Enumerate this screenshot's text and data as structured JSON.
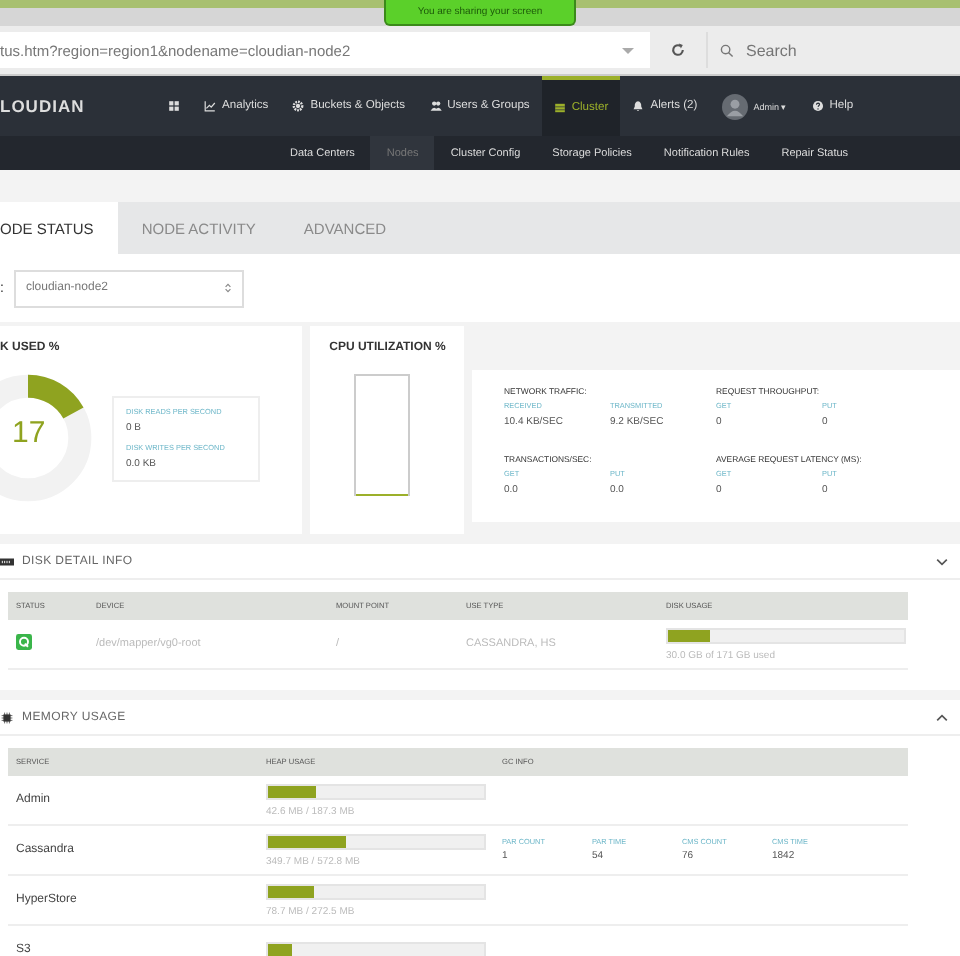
{
  "banner": "You are sharing your screen",
  "browser": {
    "url": "tus.htm?region=region1&nodename=cloudian-node2",
    "search_placeholder": "Search"
  },
  "logo": "LOUDIAN",
  "nav": [
    {
      "kind": "grid",
      "selected": false
    },
    {
      "kind": "chart",
      "label": "Analytics",
      "selected": false
    },
    {
      "kind": "gear",
      "label": "Buckets & Objects",
      "selected": false
    },
    {
      "kind": "users",
      "label": "Users & Groups",
      "selected": false
    },
    {
      "kind": "cluster",
      "label": "Cluster",
      "selected": true
    },
    {
      "kind": "bell",
      "label": "Alerts (2)",
      "selected": false
    },
    {
      "kind": "avatar",
      "label": "Admin ▾",
      "selected": false
    },
    {
      "kind": "help",
      "label": "Help",
      "selected": false
    }
  ],
  "subnav": [
    {
      "label": "Data Centers",
      "selected": false
    },
    {
      "label": "Nodes",
      "selected": true
    },
    {
      "label": "Cluster Config",
      "selected": false
    },
    {
      "label": "Storage Policies",
      "selected": false
    },
    {
      "label": "Notification Rules",
      "selected": false
    },
    {
      "label": "Repair Status",
      "selected": false
    }
  ],
  "tabs": [
    {
      "label": "ODE STATUS",
      "selected": true
    },
    {
      "label": "NODE ACTIVITY",
      "selected": false
    },
    {
      "label": "ADVANCED",
      "selected": false
    }
  ],
  "node_select": {
    "label": ":",
    "value": "cloudian-node2"
  },
  "disk_used": {
    "title": "K USED %",
    "value": "17",
    "stats": [
      {
        "label": "DISK READS PER SECOND",
        "value": "0 B"
      },
      {
        "label": "DISK WRITES PER SECOND",
        "value": "0.0 KB"
      }
    ]
  },
  "cpu": {
    "title": "CPU UTILIZATION %",
    "level": 0.02
  },
  "metrics": [
    {
      "title": "NETWORK TRAFFIC:",
      "items": [
        {
          "label": "RECEIVED",
          "value": "10.4 KB/SEC"
        },
        {
          "label": "TRANSMITTED",
          "value": "9.2 KB/SEC"
        }
      ]
    },
    {
      "title": "REQUEST THROUGHPUT:",
      "items": [
        {
          "label": "GET",
          "value": "0"
        },
        {
          "label": "PUT",
          "value": "0"
        }
      ]
    },
    {
      "title": "TRANSACTIONS/SEC:",
      "items": [
        {
          "label": "GET",
          "value": "0.0"
        },
        {
          "label": "PUT",
          "value": "0.0"
        }
      ]
    },
    {
      "title": "AVERAGE REQUEST LATENCY (MS):",
      "items": [
        {
          "label": "GET",
          "value": "0"
        },
        {
          "label": "PUT",
          "value": "0"
        }
      ]
    }
  ],
  "disk_detail": {
    "title": "DISK DETAIL INFO",
    "expanded": false,
    "columns": [
      "STATUS",
      "DEVICE",
      "MOUNT POINT",
      "USE TYPE",
      "DISK USAGE"
    ],
    "rows": [
      {
        "device": "/dev/mapper/vg0-root",
        "mount": "/",
        "use_type": "CASSANDRA, HS",
        "level": 0.18,
        "usage": "30.0 GB of 171 GB used"
      }
    ]
  },
  "memory": {
    "title": "MEMORY USAGE",
    "expanded": true,
    "columns": [
      "SERVICE",
      "HEAP USAGE",
      "GC INFO"
    ],
    "rows": [
      {
        "service": "Admin",
        "level": 0.22,
        "heap": "42.6 MB / 187.3 MB"
      },
      {
        "service": "Cassandra",
        "level": 0.36,
        "heap": "349.7 MB / 572.8 MB",
        "gc": [
          {
            "label": "PAR COUNT",
            "value": "1"
          },
          {
            "label": "PAR TIME",
            "value": "54"
          },
          {
            "label": "CMS COUNT",
            "value": "76"
          },
          {
            "label": "CMS TIME",
            "value": "1842"
          }
        ]
      },
      {
        "service": "HyperStore",
        "level": 0.21,
        "heap": "78.7 MB / 272.5 MB"
      },
      {
        "service": "S3",
        "level": 0.11
      }
    ]
  }
}
